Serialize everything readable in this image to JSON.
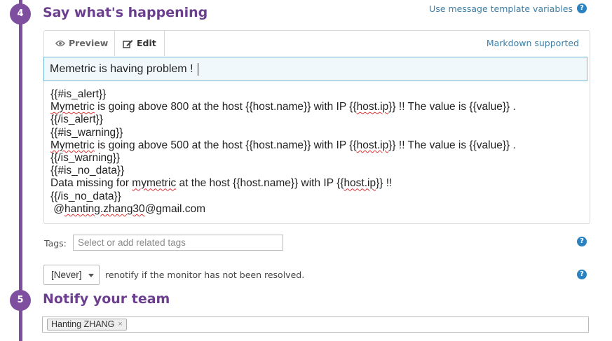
{
  "steps": {
    "say": {
      "number": "4",
      "title": "Say what's happening"
    },
    "notify": {
      "number": "5",
      "title": "Notify your team"
    }
  },
  "template_link": "Use message template variables",
  "help_icon_glyph": "?",
  "editor": {
    "tabs": [
      {
        "label": "Preview",
        "icon": "eye-icon"
      },
      {
        "label": "Edit",
        "icon": "edit-icon"
      }
    ],
    "active_tab": "Edit",
    "markdown_link": "Markdown supported",
    "subject": "Memetric is having problem !",
    "body_lines": [
      "{{#is_alert}}",
      "Mymetric is going above 800 at the host {{host.name}} with IP {{host.ip}} !! The value is {{value}} .",
      "{{/is_alert}}",
      "{{#is_warning}}",
      "Mymetric is going above 500 at the host {{host.name}} with IP {{host.ip}} !! The value is {{value}} .",
      "{{/is_warning}}",
      "{{#is_no_data}}",
      "Data missing for mymetric at the host {{host.name}} with IP {{host.ip}} !!",
      "{{/is_no_data}}",
      " @hanting.zhang30@gmail.com"
    ]
  },
  "tags": {
    "label": "Tags:",
    "placeholder": "Select or add related tags"
  },
  "renotify": {
    "selected": "[Never]",
    "text": "renotify if the monitor has not been resolved."
  },
  "team": {
    "recipients": [
      {
        "name": "Hanting ZHANG",
        "remove": "×"
      }
    ]
  },
  "colors": {
    "accent_purple": "#7e4f9e",
    "link_blue": "#3d7ea6",
    "help_blue": "#2a83c0",
    "subject_border": "#6fb6d6"
  }
}
